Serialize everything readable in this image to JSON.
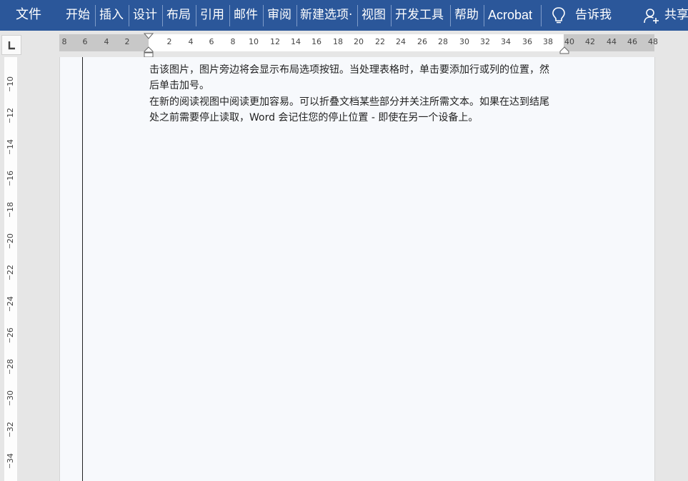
{
  "ribbon": {
    "tabs": [
      "文件",
      "开始",
      "插入",
      "设计",
      "布局",
      "引用",
      "邮件",
      "审阅",
      "新建选项·",
      "视图",
      "开发工具",
      "帮助",
      "Acrobat"
    ],
    "tell_me": "告诉我",
    "share": "共享",
    "accent_color": "#2b579a"
  },
  "ruler": {
    "horizontal_labels": [
      "8",
      "6",
      "4",
      "2",
      "2",
      "4",
      "6",
      "8",
      "10",
      "12",
      "14",
      "16",
      "18",
      "20",
      "22",
      "24",
      "26",
      "28",
      "30",
      "32",
      "34",
      "36",
      "38",
      "40",
      "42",
      "44",
      "46",
      "48"
    ],
    "vertical_labels": [
      "10",
      "12",
      "14",
      "16",
      "18",
      "20",
      "22",
      "24",
      "26",
      "28",
      "30",
      "32",
      "34"
    ]
  },
  "document": {
    "lines": [
      "击该图片，图片旁边将会显示布局选项按钮。当处理表格时，单击要添加行或列的位置，然",
      "后单击加号。",
      "在新的阅读视图中阅读更加容易。可以折叠文档某些部分并关注所需文本。如果在达到结尾",
      "处之前需要停止读取，Word 会记住您的停止位置 - 即使在另一个设备上。"
    ]
  }
}
